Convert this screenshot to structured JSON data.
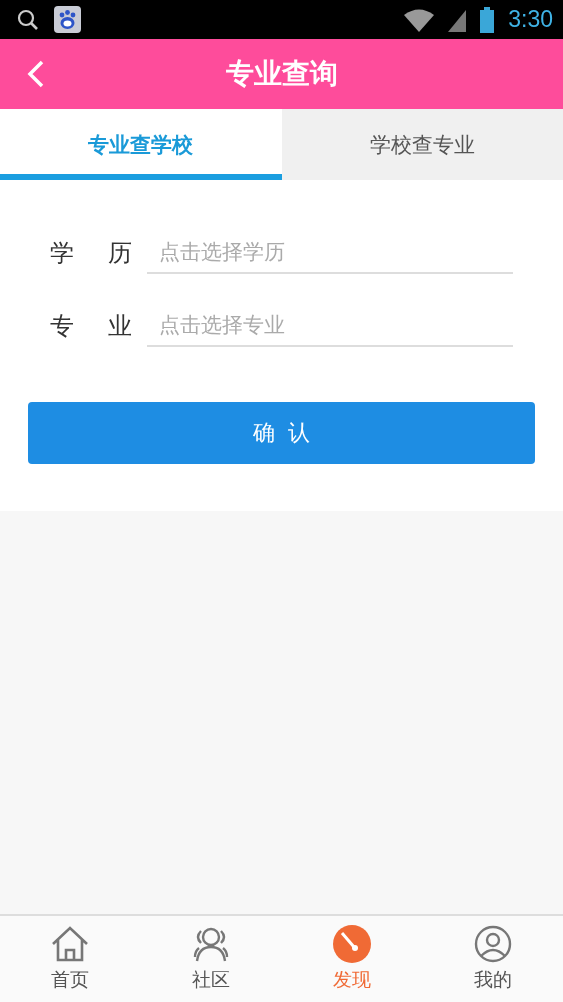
{
  "status_bar": {
    "time": "3:30"
  },
  "header": {
    "title": "专业查询"
  },
  "tabs": [
    {
      "label": "专业查学校",
      "selected": true
    },
    {
      "label": "学校查专业",
      "selected": false
    }
  ],
  "form": {
    "fields": [
      {
        "label": "学 历",
        "placeholder": "点击选择学历"
      },
      {
        "label": "专 业",
        "placeholder": "点击选择专业"
      }
    ],
    "confirm_button": "确 认"
  },
  "nav": [
    {
      "kind": "home",
      "label": "首页",
      "selected": false
    },
    {
      "kind": "community",
      "label": "社区",
      "selected": false
    },
    {
      "kind": "discover",
      "label": "发现",
      "selected": true
    },
    {
      "kind": "mine",
      "label": "我的",
      "selected": false
    }
  ]
}
